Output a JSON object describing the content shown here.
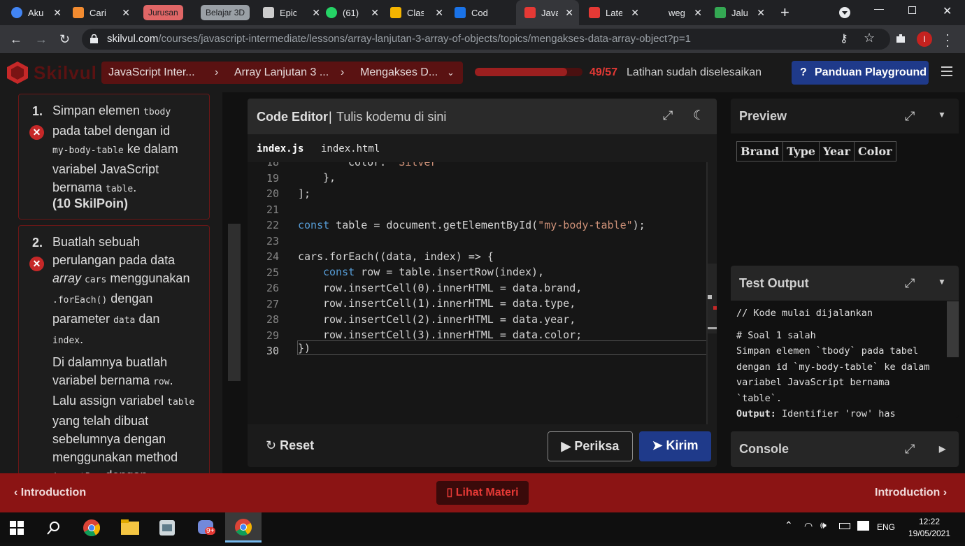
{
  "browser": {
    "tabs": [
      {
        "label": "Aku",
        "color": "#4285f4"
      },
      {
        "label": "Cari",
        "color": "#f28b30"
      },
      {
        "label": "Epic",
        "color": "#cccccc"
      },
      {
        "label": "(61)",
        "color": "#25d366"
      },
      {
        "label": "Clas",
        "color": "#f4b400"
      },
      {
        "label": "Cod",
        "color": "#1a73e8"
      },
      {
        "label": "Java",
        "color": "#e53935"
      },
      {
        "label": "Late",
        "color": "#e53935"
      },
      {
        "label": "weg",
        "color": "#333333"
      },
      {
        "label": "Jalu",
        "color": "#34a853"
      }
    ],
    "groups": [
      "Jurusan",
      "Belajar 3D"
    ],
    "url_host": "skilvul.com",
    "url_path": "/courses/javascript-intermediate/lessons/array-lanjutan-3-array-of-objects/topics/mengakses-data-array-object?p=1",
    "profile_initial": "I"
  },
  "app": {
    "logo": "Skilvul",
    "breadcrumbs": [
      "JavaScript Inter...",
      "Array Lanjutan 3 ...",
      "Mengakses D..."
    ],
    "progress_fraction": 0.86,
    "progress_text": "49/57",
    "progress_label": "Latihan sudah diselesaikan",
    "guide_button": "Panduan Playground"
  },
  "tasks": [
    {
      "number": "1.",
      "lines": [
        "Simpan elemen ",
        "tbody",
        "pada tabel dengan id",
        "my-body-table",
        " ke dalam",
        "variabel JavaScript",
        "bernama ",
        "table",
        "."
      ],
      "points": "(10 SkilPoin)"
    },
    {
      "number": "2.",
      "t": [
        "Buatlah sebuah",
        "perulangan pada data",
        "array",
        "cars",
        "menggunakan",
        ".forEach()",
        "dengan",
        "parameter",
        "data",
        "dan",
        "index",
        "."
      ],
      "t2": [
        "Di dalamnya buatlah",
        "variabel bernama",
        "row",
        ".",
        "Lalu assign variabel",
        "table",
        "yang telah dibuat",
        "sebelumnya dengan",
        "menggunakan method",
        "insertRow",
        "dengan"
      ]
    }
  ],
  "editor": {
    "title": "Code Editor",
    "subtitle": "Tulis kodemu di sini",
    "tabs": [
      "index.js",
      "index.html"
    ],
    "line_numbers": [
      "18",
      "19",
      "20",
      "21",
      "22",
      "23",
      "24",
      "25",
      "26",
      "27",
      "28",
      "29",
      "30"
    ],
    "code": {
      "l18a": "color: ",
      "l18b": "\"Silver\"",
      "l19": "},",
      "l20": "];",
      "l22a": "const",
      "l22b": " table = document.getElementById(",
      "l22c": "\"my-body-table\"",
      "l22d": ");",
      "l24": "cars.forEach((data, index) => {",
      "l25a": "const",
      "l25b": " row = table.insertRow(index),",
      "l26": "row.insertCell(0).innerHTML = data.brand,",
      "l27": "row.insertCell(1).innerHTML = data.type,",
      "l28": "row.insertCell(2).innerHTML = data.year,",
      "l29": "row.insertCell(3).innerHTML = data.color;",
      "l30": "})"
    },
    "reset": "Reset",
    "check": "Periksa",
    "submit": "Kirim"
  },
  "preview": {
    "title": "Preview",
    "headers": [
      "Brand",
      "Type",
      "Year",
      "Color"
    ]
  },
  "test_output": {
    "title": "Test Output",
    "l1": "// Kode mulai dijalankan",
    "l2": "# Soal 1 salah",
    "l3": "Simpan elemen `tbody` pada tabel",
    "l4": "dengan id `my-body-table` ke dalam",
    "l5": "variabel JavaScript bernama",
    "l6": "`table`.",
    "l7a": "Output:",
    "l7b": " Identifier 'row' has"
  },
  "console": {
    "title": "Console"
  },
  "footer": {
    "prev": "Introduction",
    "materi": "Lihat Materi",
    "next": "Introduction"
  },
  "taskbar": {
    "lang": "ENG",
    "time": "12:22",
    "date": "19/05/2021",
    "badge": "9+"
  }
}
